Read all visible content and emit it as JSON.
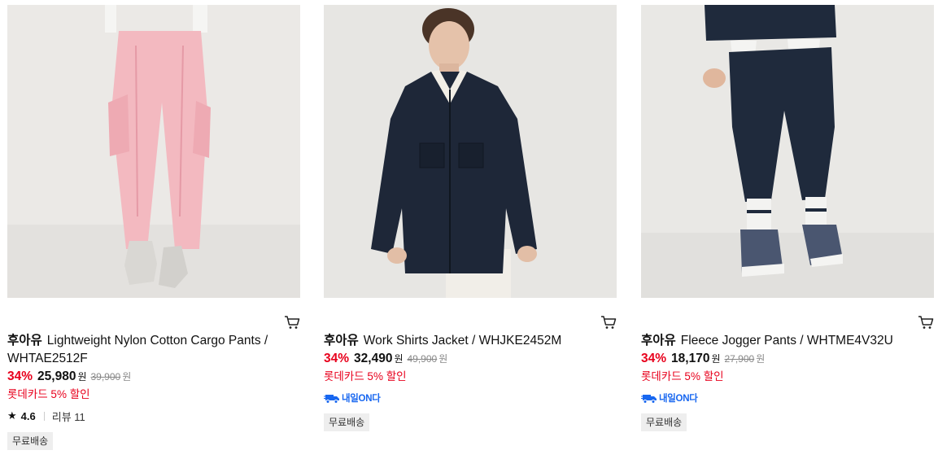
{
  "products": [
    {
      "brand": "후아유",
      "name": "Lightweight Nylon Cotton Cargo Pants / WHTAE2512F",
      "discount": "34%",
      "price": "25,980",
      "currency": "원",
      "original_price": "39,900",
      "card_promo": "롯데카드 5% 할인",
      "rating": "4.6",
      "reviews": "리뷰 11",
      "delivery": "",
      "shipping": "무료배송",
      "image_bg": "#ebe9e6",
      "product_color": "#f3b9c0"
    },
    {
      "brand": "후아유",
      "name": "Work Shirts Jacket / WHJKE2452M",
      "discount": "34%",
      "price": "32,490",
      "currency": "원",
      "original_price": "49,900",
      "card_promo": "롯데카드 5% 할인",
      "delivery": "내일ON다",
      "shipping": "무료배송",
      "image_bg": "#e7e6e3",
      "product_color": "#1e2738"
    },
    {
      "brand": "후아유",
      "name": "Fleece Jogger Pants / WHTME4V32U",
      "discount": "34%",
      "price": "18,170",
      "currency": "원",
      "original_price": "27,900",
      "card_promo": "롯데카드 5% 할인",
      "delivery": "내일ON다",
      "shipping": "무료배송",
      "image_bg": "#e9e8e5",
      "product_color": "#1f2a3c"
    }
  ],
  "colors": {
    "discount": "#e8001c",
    "delivery": "#1867f0",
    "tag_bg": "#eeeeee"
  },
  "icons": {
    "cart": "cart-icon",
    "star": "star-icon",
    "delivery": "delivery-truck-icon"
  }
}
